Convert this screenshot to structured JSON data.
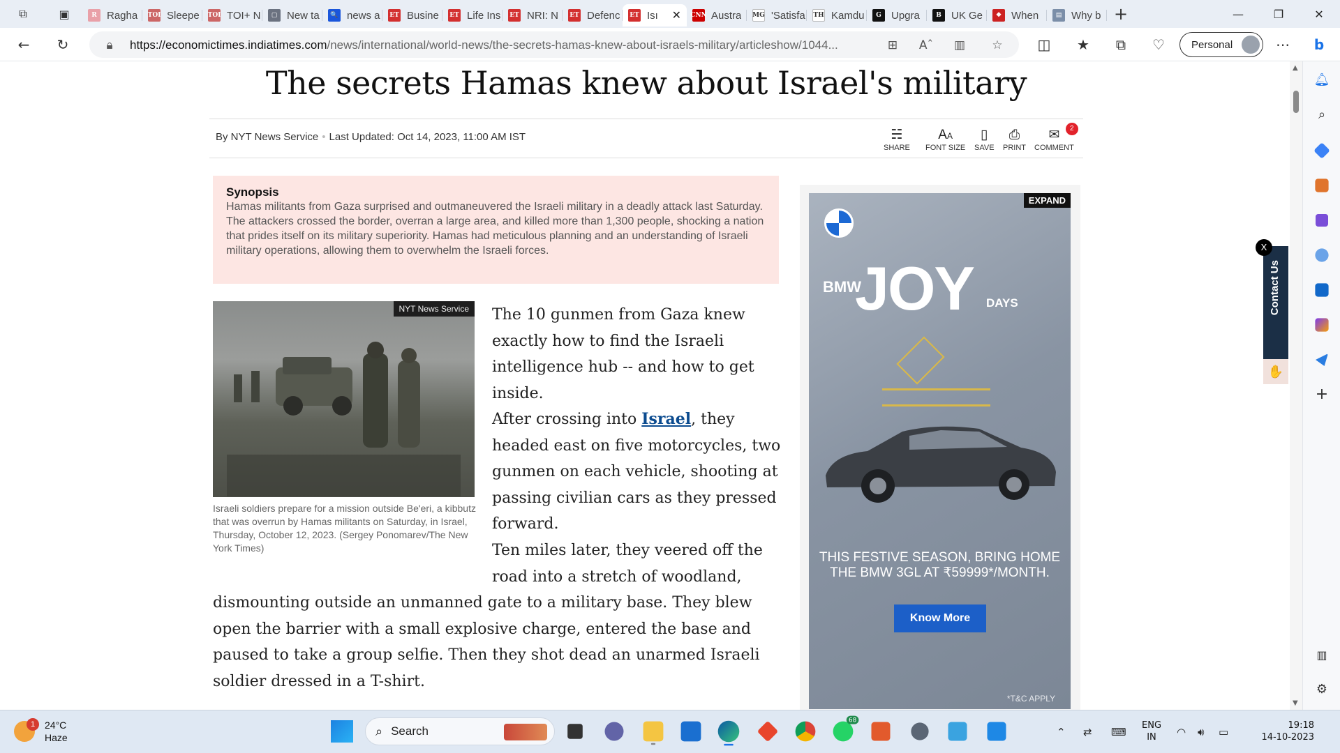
{
  "browser": {
    "tabs": [
      {
        "label": "Ragha",
        "favicon": "R",
        "color": "#e9a0a8"
      },
      {
        "label": "Sleepe",
        "favicon": "TOI",
        "color": "#cc6666"
      },
      {
        "label": "TOI+ N",
        "favicon": "TOI",
        "color": "#cc6666"
      },
      {
        "label": "New ta",
        "favicon": "▢",
        "color": "#6b7280"
      },
      {
        "label": "news a",
        "favicon": "🔍",
        "color": "#1a56db"
      },
      {
        "label": "Busine",
        "favicon": "ET",
        "color": "#d32f2f"
      },
      {
        "label": "Life Ins",
        "favicon": "ET",
        "color": "#d32f2f"
      },
      {
        "label": "NRI: N",
        "favicon": "ET",
        "color": "#d32f2f"
      },
      {
        "label": "Defenc",
        "favicon": "ET",
        "color": "#d32f2f"
      },
      {
        "label": "Isı",
        "favicon": "ET",
        "color": "#d32f2f"
      },
      {
        "label": "Austra",
        "favicon": "CNN",
        "color": "#cc0000"
      },
      {
        "label": "'Satisfa",
        "favicon": "MG",
        "color": "#ffffff"
      },
      {
        "label": "Kamdu",
        "favicon": "TH",
        "color": "#ffffff"
      },
      {
        "label": "Upgra",
        "favicon": "G",
        "color": "#111111"
      },
      {
        "label": "UK Ge",
        "favicon": "B",
        "color": "#111111"
      },
      {
        "label": "When",
        "favicon": "❖",
        "color": "#cc2222"
      },
      {
        "label": "Why b",
        "favicon": "▤",
        "color": "#7b8ea8"
      }
    ],
    "active_tab": 9,
    "url_host": "https://economictimes.indiatimes.com",
    "url_path": "/news/international/world-news/the-secrets-hamas-knew-about-israels-military/articleshow/1044...",
    "profile_label": "Personal"
  },
  "article": {
    "title": "The secrets Hamas knew about Israel's military",
    "author": "By NYT News Service",
    "updated": "Last Updated: Oct 14, 2023, 11:00 AM IST",
    "actions": {
      "share": "SHARE",
      "font_size": "FONT SIZE",
      "save": "SAVE",
      "print": "PRINT",
      "comment": "COMMENT",
      "comment_count": "2"
    },
    "synopsis_heading": "Synopsis",
    "synopsis_text": "Hamas militants from Gaza surprised and outmaneuvered the Israeli military in a deadly attack last Saturday. The attackers crossed the border, overran a large area, and killed more than 1,300 people, shocking a nation that prides itself on its military superiority. Hamas had meticulous planning and an understanding of Israeli military operations, allowing them to overwhelm the Israeli forces.",
    "photo_credit": "NYT News Service",
    "photo_caption": "Israeli soldiers prepare for a mission outside Be'eri, a kibbutz that was overrun by Hamas militants on Saturday, in Israel, Thursday, October 12, 2023. (Sergey Ponomarev/The New York Times)",
    "para1": "The 10 gunmen from Gaza knew exactly how to find the Israeli intelligence hub -- and how to get inside.",
    "para2_before": "After crossing into ",
    "para2_link": "Israel",
    "para2_after": ", they headed east on five motorcycles, two gunmen on each vehicle, shooting at passing civilian cars as they pressed forward.",
    "para3_a": "Ten miles later, they veered off the road into a stretch of woodland,",
    "para3_b": "dismounting outside an unmanned gate to a military base. They blew open the barrier with a small explosive charge, entered the base and paused to take a group selfie. Then they shot dead an unarmed Israeli soldier dressed in a T-shirt."
  },
  "ad": {
    "expand": "EXPAND",
    "brand": "BMW",
    "headline": "JOY",
    "sub": "DAYS",
    "offer": "THIS FESTIVE SEASON, BRING HOME THE BMW 3GL AT ₹59999*/MONTH.",
    "cta": "Know More",
    "tc": "*T&C APPLY"
  },
  "contact": {
    "label": "Contact Us",
    "close": "X"
  },
  "taskbar": {
    "weather_temp": "24°C",
    "weather_desc": "Haze",
    "weather_badge": "1",
    "search_label": "Search",
    "whatsapp_badge": "68",
    "lang_top": "ENG",
    "lang_bottom": "IN",
    "time": "19:18",
    "date": "14-10-2023"
  }
}
